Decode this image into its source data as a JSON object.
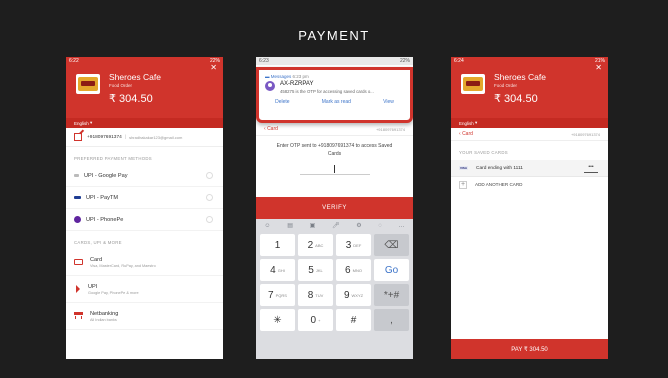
{
  "title": "PAYMENT",
  "phone1": {
    "status_time": "6:22",
    "status_right": "22%",
    "merchant_name": "Sheroes Cafe",
    "merchant_sub": "Food Order",
    "amount": "₹ 304.50",
    "language": "English",
    "phone": "+918097691374",
    "email": "shradhakakar123@gmail.com",
    "preferred_header": "PREFERRED PAYMENT METHODS",
    "methods": [
      "UPI - Google Pay",
      "UPI - PayTM",
      "UPI - PhonePe"
    ],
    "more_header": "CARDS, UPI & MORE",
    "options": [
      {
        "title": "Card",
        "desc": "Visa, MasterCard, RuPay, and Maestro"
      },
      {
        "title": "UPI",
        "desc": "Google Pay, PhonePe & more"
      },
      {
        "title": "Netbanking",
        "desc": "All Indian banks"
      }
    ]
  },
  "phone2": {
    "status_time": "6:23",
    "status_right": "22%",
    "notif_app": "Messages",
    "notif_time": "6:23 pm",
    "notif_sender": "AX-RZRPAY",
    "notif_text": "458275 is the OTP for accessing saved cards o...",
    "notif_actions": [
      "Delete",
      "Mark as read",
      "View"
    ],
    "back_label": "Card",
    "phone": "+918097691374",
    "otp_info": "Enter OTP sent to +918097691374 to access Saved Cards",
    "verify": "VERIFY",
    "keys": [
      {
        "n": "1",
        "l": ""
      },
      {
        "n": "2",
        "l": "ABC"
      },
      {
        "n": "3",
        "l": "DEF"
      },
      {
        "n": "⌫",
        "l": ""
      },
      {
        "n": "4",
        "l": "GHI"
      },
      {
        "n": "5",
        "l": "JKL"
      },
      {
        "n": "6",
        "l": "MNO"
      },
      {
        "n": "Go",
        "l": ""
      },
      {
        "n": "7",
        "l": "PQRS"
      },
      {
        "n": "8",
        "l": "TUV"
      },
      {
        "n": "9",
        "l": "WXYZ"
      },
      {
        "n": "*+#",
        "l": ""
      },
      {
        "n": "✳",
        "l": ""
      },
      {
        "n": "0",
        "l": "+"
      },
      {
        "n": "#",
        "l": ""
      },
      {
        "n": ",",
        "l": ""
      }
    ]
  },
  "phone3": {
    "status_time": "6:24",
    "status_right": "21%",
    "merchant_name": "Sheroes Cafe",
    "merchant_sub": "Food Order",
    "amount": "₹ 304.50",
    "language": "English",
    "back_label": "Card",
    "phone": "+918097691374",
    "saved_header": "YOUR SAVED CARDS",
    "card_brand": "VISA",
    "card_text": "Card ending with 1111",
    "cvv": "•••",
    "add_card": "ADD ANOTHER CARD",
    "pay_button": "PAY ₹ 304.50"
  }
}
